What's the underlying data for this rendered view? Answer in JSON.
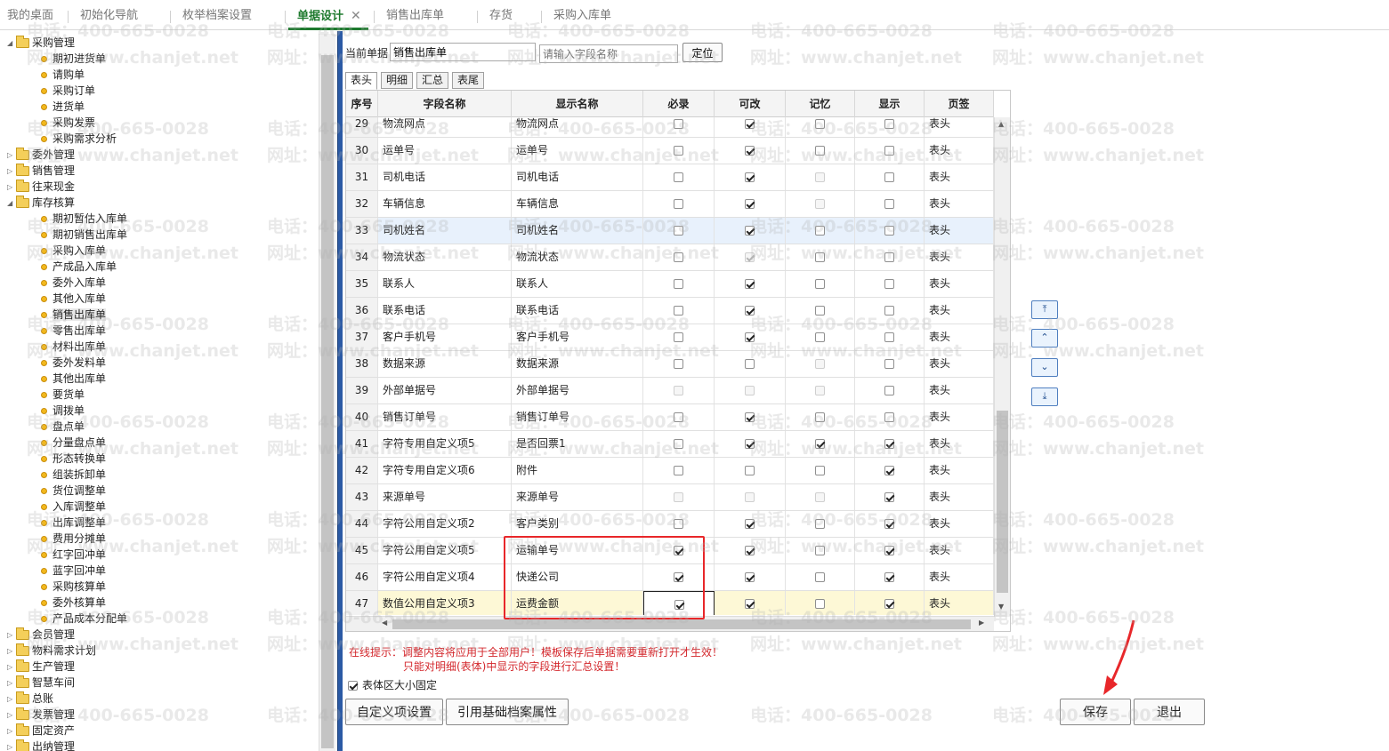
{
  "tabs": [
    {
      "label": "我的桌面",
      "active": false
    },
    {
      "label": "初始化导航",
      "active": false
    },
    {
      "label": "枚举档案设置",
      "active": false
    },
    {
      "label": "单据设计",
      "active": true,
      "close": "✕"
    },
    {
      "label": "销售出库单",
      "active": false
    },
    {
      "label": "存货",
      "active": false
    },
    {
      "label": "采购入库单",
      "active": false
    }
  ],
  "tree": [
    {
      "label": "采购管理",
      "type": "folder",
      "expanded": true
    },
    {
      "label": "期初进货单",
      "type": "leaf"
    },
    {
      "label": "请购单",
      "type": "leaf"
    },
    {
      "label": "采购订单",
      "type": "leaf"
    },
    {
      "label": "进货单",
      "type": "leaf"
    },
    {
      "label": "采购发票",
      "type": "leaf"
    },
    {
      "label": "采购需求分析",
      "type": "leaf"
    },
    {
      "label": "委外管理",
      "type": "folder",
      "expanded": false
    },
    {
      "label": "销售管理",
      "type": "folder",
      "expanded": false
    },
    {
      "label": "往来现金",
      "type": "folder",
      "expanded": false
    },
    {
      "label": "库存核算",
      "type": "folder",
      "expanded": true
    },
    {
      "label": "期初暂估入库单",
      "type": "leaf"
    },
    {
      "label": "期初销售出库单",
      "type": "leaf"
    },
    {
      "label": "采购入库单",
      "type": "leaf"
    },
    {
      "label": "产成品入库单",
      "type": "leaf"
    },
    {
      "label": "委外入库单",
      "type": "leaf"
    },
    {
      "label": "其他入库单",
      "type": "leaf"
    },
    {
      "label": "销售出库单",
      "type": "leaf",
      "selected": true
    },
    {
      "label": "零售出库单",
      "type": "leaf"
    },
    {
      "label": "材料出库单",
      "type": "leaf"
    },
    {
      "label": "委外发料单",
      "type": "leaf"
    },
    {
      "label": "其他出库单",
      "type": "leaf"
    },
    {
      "label": "要货单",
      "type": "leaf"
    },
    {
      "label": "调拨单",
      "type": "leaf"
    },
    {
      "label": "盘点单",
      "type": "leaf"
    },
    {
      "label": "分量盘点单",
      "type": "leaf"
    },
    {
      "label": "形态转换单",
      "type": "leaf"
    },
    {
      "label": "组装拆卸单",
      "type": "leaf"
    },
    {
      "label": "货位调整单",
      "type": "leaf"
    },
    {
      "label": "入库调整单",
      "type": "leaf"
    },
    {
      "label": "出库调整单",
      "type": "leaf"
    },
    {
      "label": "费用分摊单",
      "type": "leaf"
    },
    {
      "label": "红字回冲单",
      "type": "leaf"
    },
    {
      "label": "蓝字回冲单",
      "type": "leaf"
    },
    {
      "label": "采购核算单",
      "type": "leaf"
    },
    {
      "label": "委外核算单",
      "type": "leaf"
    },
    {
      "label": "产品成本分配单",
      "type": "leaf"
    },
    {
      "label": "会员管理",
      "type": "folder",
      "expanded": false
    },
    {
      "label": "物料需求计划",
      "type": "folder",
      "expanded": false
    },
    {
      "label": "生产管理",
      "type": "folder",
      "expanded": false
    },
    {
      "label": "智慧车间",
      "type": "folder",
      "expanded": false
    },
    {
      "label": "总账",
      "type": "folder",
      "expanded": false
    },
    {
      "label": "发票管理",
      "type": "folder",
      "expanded": false
    },
    {
      "label": "固定资产",
      "type": "folder",
      "expanded": false
    },
    {
      "label": "出纳管理",
      "type": "folder",
      "expanded": false
    }
  ],
  "doc": {
    "label": "当前单据",
    "value": "销售出库单",
    "search_placeholder": "请输入字段名称",
    "locate_label": "定位"
  },
  "subtabs": [
    {
      "label": "表头",
      "active": true
    },
    {
      "label": "明细",
      "active": false
    },
    {
      "label": "汇总",
      "active": false
    },
    {
      "label": "表尾",
      "active": false
    }
  ],
  "grid": {
    "headers": [
      "序号",
      "字段名称",
      "显示名称",
      "必录",
      "可改",
      "记忆",
      "显示",
      "页签"
    ],
    "rows": [
      {
        "seq": "29",
        "field": "物流网点",
        "display": "物流网点",
        "req": "u",
        "edit": "c",
        "mem": "u",
        "show": "u",
        "page": "表头"
      },
      {
        "seq": "30",
        "field": "运单号",
        "display": "运单号",
        "req": "u",
        "edit": "c",
        "mem": "u",
        "show": "u",
        "page": "表头"
      },
      {
        "seq": "31",
        "field": "司机电话",
        "display": "司机电话",
        "req": "u",
        "edit": "c",
        "mem": "du",
        "show": "u",
        "page": "表头"
      },
      {
        "seq": "32",
        "field": "车辆信息",
        "display": "车辆信息",
        "req": "u",
        "edit": "c",
        "mem": "du",
        "show": "u",
        "page": "表头"
      },
      {
        "seq": "33",
        "field": "司机姓名",
        "display": "司机姓名",
        "req": "u",
        "edit": "c",
        "mem": "u",
        "show": "u",
        "page": "表头",
        "state": "hover"
      },
      {
        "seq": "34",
        "field": "物流状态",
        "display": "物流状态",
        "req": "u",
        "edit": "dc",
        "mem": "u",
        "show": "u",
        "page": "表头"
      },
      {
        "seq": "35",
        "field": "联系人",
        "display": "联系人",
        "req": "u",
        "edit": "c",
        "mem": "u",
        "show": "u",
        "page": "表头"
      },
      {
        "seq": "36",
        "field": "联系电话",
        "display": "联系电话",
        "req": "u",
        "edit": "c",
        "mem": "u",
        "show": "u",
        "page": "表头"
      },
      {
        "seq": "37",
        "field": "客户手机号",
        "display": "客户手机号",
        "req": "u",
        "edit": "c",
        "mem": "u",
        "show": "u",
        "page": "表头"
      },
      {
        "seq": "38",
        "field": "数据来源",
        "display": "数据来源",
        "req": "u",
        "edit": "u",
        "mem": "du",
        "show": "u",
        "page": "表头"
      },
      {
        "seq": "39",
        "field": "外部单据号",
        "display": "外部单据号",
        "req": "du",
        "edit": "du",
        "mem": "du",
        "show": "u",
        "page": "表头"
      },
      {
        "seq": "40",
        "field": "销售订单号",
        "display": "销售订单号",
        "req": "u",
        "edit": "c",
        "mem": "u",
        "show": "u",
        "page": "表头"
      },
      {
        "seq": "41",
        "field": "字符专用自定义项5",
        "display": "是否回票1",
        "req": "u",
        "edit": "c",
        "mem": "c",
        "show": "c",
        "page": "表头"
      },
      {
        "seq": "42",
        "field": "字符专用自定义项6",
        "display": "附件",
        "req": "u",
        "edit": "u",
        "mem": "u",
        "show": "c",
        "page": "表头"
      },
      {
        "seq": "43",
        "field": "来源单号",
        "display": "来源单号",
        "req": "du",
        "edit": "du",
        "mem": "du",
        "show": "c",
        "page": "表头"
      },
      {
        "seq": "44",
        "field": "字符公用自定义项2",
        "display": "客户类别",
        "req": "u",
        "edit": "c",
        "mem": "u",
        "show": "c",
        "page": "表头"
      },
      {
        "seq": "45",
        "field": "字符公用自定义项5",
        "display": "运输单号",
        "req": "c",
        "edit": "c",
        "mem": "u",
        "show": "c",
        "page": "表头"
      },
      {
        "seq": "46",
        "field": "字符公用自定义项4",
        "display": "快递公司",
        "req": "c",
        "edit": "c",
        "mem": "u",
        "show": "c",
        "page": "表头"
      },
      {
        "seq": "47",
        "field": "数值公用自定义项3",
        "display": "运费金额",
        "req": "c",
        "edit": "c",
        "mem": "u",
        "show": "c",
        "page": "表头",
        "state": "current"
      }
    ]
  },
  "move_buttons": [
    {
      "name": "move-top-button",
      "glyph": "⤒"
    },
    {
      "name": "move-up-button",
      "glyph": "⌃"
    },
    {
      "name": "move-down-button",
      "glyph": "⌄"
    },
    {
      "name": "move-bottom-button",
      "glyph": "⤓"
    }
  ],
  "tip_line1": "在线提示：调整内容将应用于全部用户！模板保存后单据需要重新打开才生效！",
  "tip_line2": "只能对明细(表体)中显示的字段进行汇总设置！",
  "fixed_size_label": "表体区大小固定",
  "fixed_size_checked": true,
  "buttons": {
    "custom_items": "自定义项设置",
    "ref_base": "引用基础档案属性",
    "save": "保存",
    "exit": "退出"
  },
  "watermark": {
    "phone": "电话：400-665-0028",
    "site": "网址：www.chanjet.net"
  },
  "colors": {
    "accent_green": "#1e7a2e",
    "splitter_blue": "#2b5aa5",
    "tip_red": "#d3262b",
    "highlight_red": "#e8272a",
    "current_row": "#fdf8d6",
    "hover_row": "#e8f1fc"
  }
}
